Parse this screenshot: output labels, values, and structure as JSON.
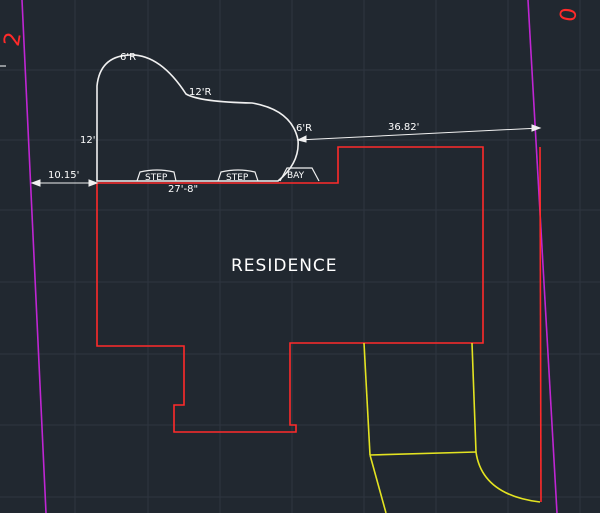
{
  "colors": {
    "background": "#212830",
    "grid": "#2e3640",
    "property_line": "#c026d3",
    "residence_outline": "#ff2a2a",
    "hardscape": "#e3e321",
    "pool_outline": "#f0f0f0",
    "text": "#ffffff"
  },
  "labels": {
    "residence": "RESIDENCE",
    "radius_top_left": "6'R",
    "radius_top_right": "12'R",
    "radius_right": "6'R",
    "depth": "12'",
    "width": "27'-8\"",
    "step_1": "STEP",
    "step_2": "STEP",
    "bay": "BAY",
    "left_setback": "10.15'",
    "right_setback": "36.82'",
    "corner_left": "2",
    "corner_right": "0"
  }
}
